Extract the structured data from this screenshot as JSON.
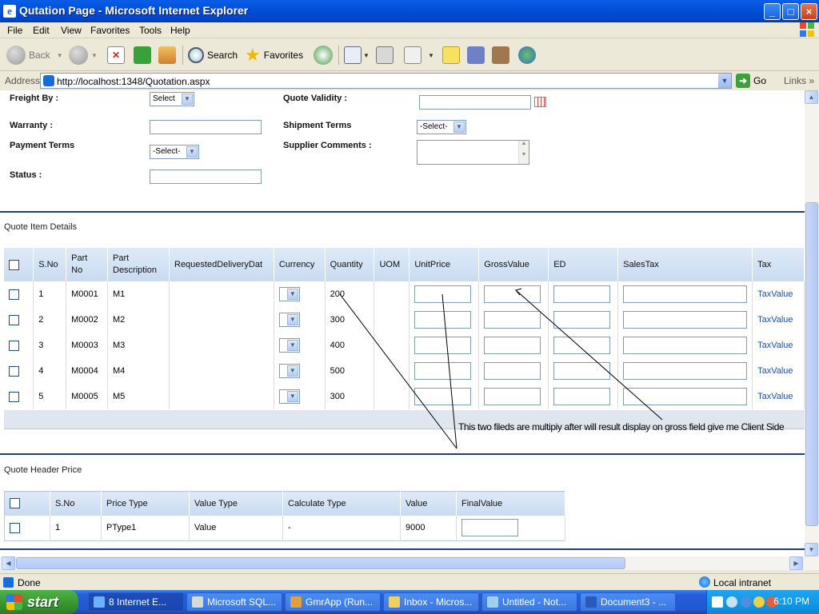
{
  "window": {
    "title": "Qutation Page - Microsoft Internet Explorer",
    "minimize": "_",
    "maximize": "□",
    "close": "×"
  },
  "menu": [
    "File",
    "Edit",
    "View",
    "Favorites",
    "Tools",
    "Help"
  ],
  "toolbar": {
    "back": "Back",
    "search": "Search",
    "favorites": "Favorites"
  },
  "address": {
    "label": "Address",
    "url": "http://localhost:1348/Quotation.aspx",
    "go": "Go",
    "links": "Links"
  },
  "form": {
    "freight_by": {
      "label": "Freight By :",
      "value": "Select"
    },
    "quote_validity": {
      "label": "Quote Validity :"
    },
    "warranty": {
      "label": "Warranty :"
    },
    "shipment_terms": {
      "label": "Shipment Terms",
      "value": "-Select-"
    },
    "payment_terms": {
      "label": "Payment Terms",
      "value": "-Select-"
    },
    "supplier_comments": {
      "label": "Supplier Comments :"
    },
    "status": {
      "label": "Status :"
    }
  },
  "quote_items": {
    "title": "Quote Item Details",
    "columns": [
      "S.No",
      "Part No",
      "Part Description",
      "RequestedDeliveryDat",
      "Currency",
      "Quantity",
      "UOM",
      "UnitPrice",
      "GrossValue",
      "ED",
      "SalesTax",
      "Tax"
    ],
    "rows": [
      {
        "sno": "1",
        "part_no": "M0001",
        "desc": "M1",
        "qty": "200",
        "tax_link": "TaxValue"
      },
      {
        "sno": "2",
        "part_no": "M0002",
        "desc": "M2",
        "qty": "300",
        "tax_link": "TaxValue"
      },
      {
        "sno": "3",
        "part_no": "M0003",
        "desc": "M3",
        "qty": "400",
        "tax_link": "TaxValue"
      },
      {
        "sno": "4",
        "part_no": "M0004",
        "desc": "M4",
        "qty": "500",
        "tax_link": "TaxValue"
      },
      {
        "sno": "5",
        "part_no": "M0005",
        "desc": "M5",
        "qty": "300",
        "tax_link": "TaxValue"
      }
    ]
  },
  "annotation": "This two fileds are multipiy after will result display on gross field  give me Client Side",
  "quote_header": {
    "title": "Quote Header Price",
    "columns": [
      "S.No",
      "Price Type",
      "Value Type",
      "Calculate Type",
      "Value",
      "FinalValue"
    ],
    "rows": [
      {
        "sno": "1",
        "price_type": "PType1",
        "value_type": "Value",
        "calc_type": "-",
        "value": "9000"
      }
    ]
  },
  "status": {
    "text": "Done",
    "zone": "Local intranet"
  },
  "taskbar": {
    "start": "start",
    "tasks": [
      "8 Internet E...",
      "Microsoft SQL...",
      "GmrApp (Run...",
      "Inbox - Micros...",
      "Untitled - Not...",
      "Document3 - ..."
    ],
    "clock": "6:10 PM"
  }
}
